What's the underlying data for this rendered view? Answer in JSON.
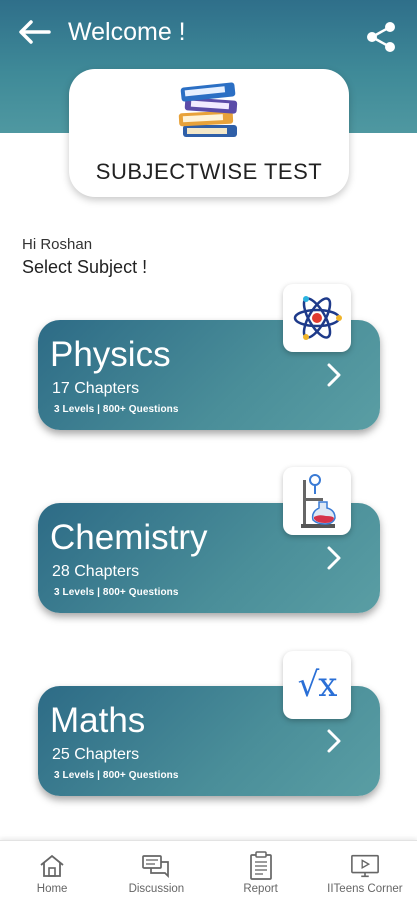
{
  "header": {
    "title": "Welcome !",
    "back_icon": "arrow-left-icon",
    "share_icon": "share-icon",
    "color": "#3a8294"
  },
  "hero": {
    "title": "SUBJECTWISE TEST",
    "icon": "books-stack-icon"
  },
  "greeting": "Hi Roshan",
  "select_label": "Select Subject !",
  "subjects": [
    {
      "name": "Physics",
      "chapters": "17 Chapters",
      "meta": "3 Levels | 800+ Questions",
      "icon": "atom-icon"
    },
    {
      "name": "Chemistry",
      "chapters": "28 Chapters",
      "meta": "3 Levels | 800+ Questions",
      "icon": "flask-icon"
    },
    {
      "name": "Maths",
      "chapters": "25 Chapters",
      "meta": "3 Levels | 800+ Questions",
      "icon": "square-root-icon",
      "icon_text": "√x"
    }
  ],
  "nav": [
    {
      "label": "Home",
      "icon": "home-icon"
    },
    {
      "label": "Discussion",
      "icon": "chat-icon"
    },
    {
      "label": "Report",
      "icon": "clipboard-icon"
    },
    {
      "label": "IITeens Corner",
      "icon": "video-screen-icon"
    }
  ],
  "colors": {
    "card_gradient_start": "#2d6b86",
    "card_gradient_end": "#5a9ea4",
    "accent_blue": "#2a6fd6"
  }
}
